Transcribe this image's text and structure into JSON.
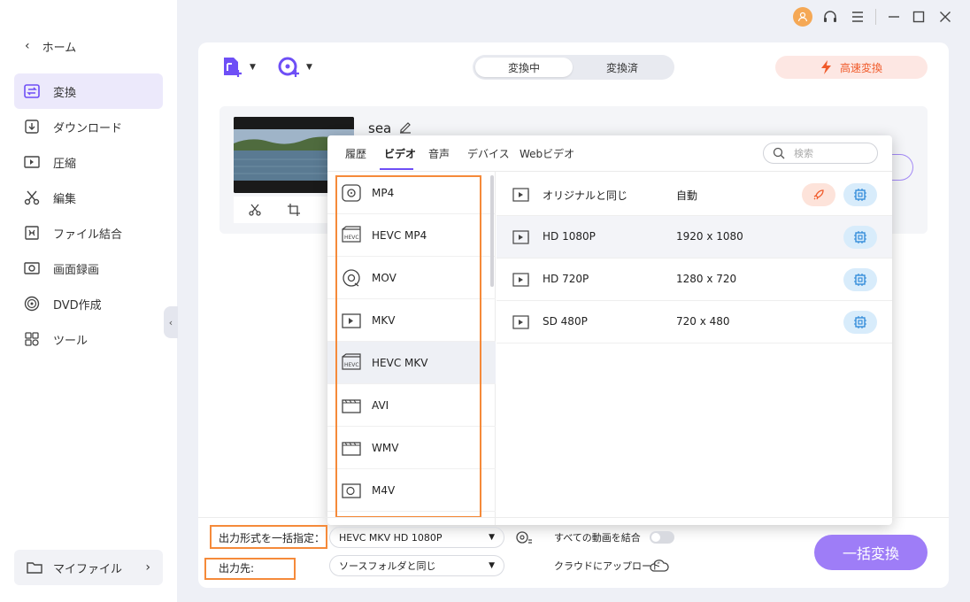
{
  "sidebar": {
    "home_label": "ホーム",
    "items": [
      {
        "label": "変換",
        "icon": "convert-icon"
      },
      {
        "label": "ダウンロード",
        "icon": "download-icon"
      },
      {
        "label": "圧縮",
        "icon": "compress-icon"
      },
      {
        "label": "編集",
        "icon": "edit-scissors-icon"
      },
      {
        "label": "ファイル結合",
        "icon": "merge-icon"
      },
      {
        "label": "画面録画",
        "icon": "screen-record-icon"
      },
      {
        "label": "DVD作成",
        "icon": "dvd-icon"
      },
      {
        "label": "ツール",
        "icon": "tools-icon"
      }
    ],
    "myfile_label": "マイファイル"
  },
  "header": {
    "tab_converting": "変換中",
    "tab_converted": "変換済",
    "speed_label": "高速変換"
  },
  "file": {
    "name": "sea"
  },
  "format_panel": {
    "tabs": [
      "履歴",
      "ビデオ",
      "音声",
      "デバイス",
      "Webビデオ"
    ],
    "active_tab": "ビデオ",
    "search_placeholder": "検索",
    "formats": [
      "MP4",
      "HEVC MP4",
      "MOV",
      "MKV",
      "HEVC MKV",
      "AVI",
      "WMV",
      "M4V"
    ],
    "selected_format": "HEVC MKV",
    "qualities": [
      {
        "name": "オリジナルと同じ",
        "resolution": "自動"
      },
      {
        "name": "HD 1080P",
        "resolution": "1920 x 1080"
      },
      {
        "name": "HD 720P",
        "resolution": "1280 x 720"
      },
      {
        "name": "SD 480P",
        "resolution": "720 x 480"
      }
    ]
  },
  "bottom": {
    "output_format_label": "出力形式を一括指定：",
    "output_format_value": "HEVC MKV HD 1080P",
    "merge_label": "すべての動画を結合",
    "output_dest_label": "出力先:",
    "output_dest_value": "ソースフォルダと同じ",
    "cloud_label": "クラウドにアップロード",
    "convert_all_label": "一括変換"
  },
  "colors": {
    "accent": "#6e4ff6",
    "convert_button": "#9e7df7",
    "highlight_box": "#f58a3a",
    "speed_text": "#f05a2a"
  }
}
